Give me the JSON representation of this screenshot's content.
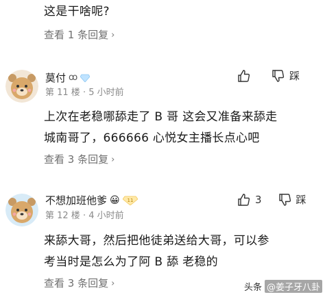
{
  "top": {
    "partial_text": "这是干啥呢?",
    "view_replies": "查看 1 条回复"
  },
  "comments": [
    {
      "username": "莫付",
      "user_suffix": "ꝏ",
      "floor": "第 11 楼",
      "time": "5 小时前",
      "like_count": "",
      "dislike_label": "踩",
      "text_lines": [
        "上次在老稳哪舔走了 B 哥 这会又准备来舔走",
        "城南哥了，666666 心悦女主播长点心吧"
      ],
      "view_replies": "查看 3 条回复",
      "badge_color": "#bfe3ff"
    },
    {
      "username": "不想加班他爹",
      "user_suffix": "😀",
      "badge_text": "11",
      "floor": "第 12 楼",
      "time": "4 小时前",
      "like_count": "3",
      "dislike_label": "踩",
      "text_lines": [
        "来舔大哥，然后把他徒弟送给大哥，可以参",
        "考当时是怎么为了阿 B 舔 老稳的"
      ],
      "view_replies": "查看 3 条回复",
      "badge_color": "#ffe9a8"
    }
  ],
  "watermark": {
    "prefix": "头条",
    "name": "@姜子牙八卦"
  },
  "colors": {
    "text": "#1a1a1a",
    "muted": "#6f6f6f",
    "meta": "#8a8a8a"
  }
}
